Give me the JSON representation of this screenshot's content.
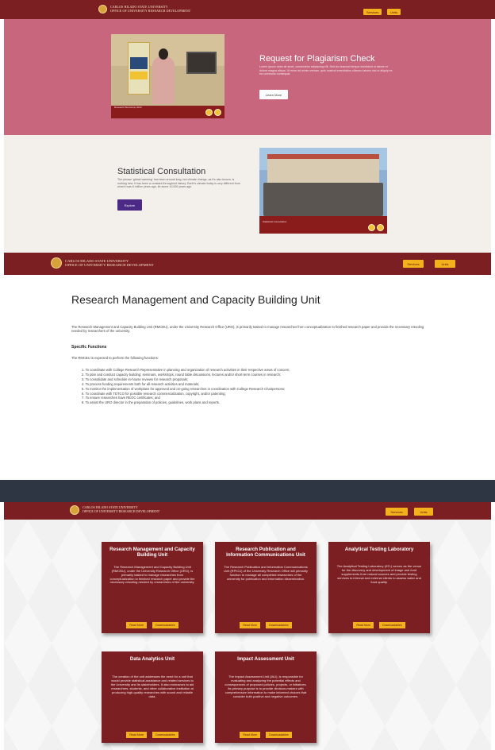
{
  "header": {
    "org_line1": "CARLOS HILADO STATE UNIVERSITY",
    "org_line2": "OFFICE OF UNIVERSITY RESEARCH DEVELOPMENT",
    "btn_left": "Services",
    "btn_right": "Units"
  },
  "plagiarism": {
    "title": "Request for Plagiarism Check",
    "description": "Lorem ipsum dolor sit amet, consectetur adipiscing elit. Sed do eiusmod tempor incididunt ut labore et dolore magna aliqua. Ut enim ad minim veniam, quis nostrud exercitation ullamco laboris nisi ut aliquip ex ea commodo consequat.",
    "button": "Learn More",
    "photo_caption": "Research Bootcamp 2022",
    "banner_text": "RESEARCH BOOTCAMP 2022"
  },
  "statistical": {
    "title": "Statistical Consultation",
    "description": "The phrase 'global warming' has been around long, but climate change, as it's also known, is nothing new. It has been a constant throughout history. Earth's climate today is very different from what it was 8 million years ago, let alone 10,000 years ago.",
    "button": "Explore",
    "photo_caption": "Statistical Consultation"
  },
  "rm_unit": {
    "title": "Research Management and Capacity Building Unit",
    "intro": "The Research Management and Capacity Building Unit (RMCBU), under the University Research Office (URO), is primarily tasked to manage researches from conceptualization to finished research paper and provide the necessary retooling needed by researchers of the university.",
    "functions_heading": "Specific Functions",
    "expected": "The RMCBU is expected to perform the following functions:",
    "functions": [
      "1. To coordinate with College Research Representative in planning and organization of research activities in their respective areas of concern;",
      "2. To plan and conduct capacity building: seminars, workshops, round table discussions, lectures and/or short-term courses in research;",
      "3. To consolidate and schedule in-house reviews for research proposals;",
      "4. To process funding requirements both for all research activities and materials;",
      "5. To monitor the implementation of workplans for approved and on-going researches in coordination with College Research Chairpersons;",
      "6. To coordinate with TDTCO for possible research commercialization, copyright, and/or patenting;",
      "7. To ensure researches have REOC certificates; and",
      "8. To assist the URO director in the preparation of policies, guidelines, work plans and reports."
    ]
  },
  "units": {
    "read_more": "Read More",
    "downloadables": "Downloadables",
    "cards": [
      {
        "title": "Research Management and Capacity Building Unit",
        "description": "The Research Management and Capacity Building Unit (RMCBU), under the University Research Office (URO), is primarily tasked to manage researches from conceptualization to finished research paper and provide the necessary retooling needed by researchers of the university."
      },
      {
        "title": "Research Publication and Information Communications Unit",
        "description": "The Research Publication and Information Communications Unit (RPICU) of the University Research Office will primarily function to manage all completed researches of the university for publication and information dissemination."
      },
      {
        "title": "Analytical Testing Laboratory",
        "description": "The Analytical Testing Laboratory (ATL) serves as the venue for the discovery and development of image and food supplements from natural sources and provide testing services to internal and external clients to assess water and food quality."
      },
      {
        "title": "Data Analytics Unit",
        "description": "The creation of the unit addresses the need for a unit that would provide statistical assistance and related services to the University and its stakeholders. It also endeavors to aid researchers, students, and other collaborative institution at producing high-quality researches with sound and reliable data."
      },
      {
        "title": "Impact Assessment Unit",
        "description": "The Impact Assessment Unit (IAU), is responsible for evaluating and analyzing the potential effects and consequences of proposed policies, projects, or initiatives. Its primary purpose is to provide decision-makers with comprehensive information to make informed choices that consider both positive and negative outcomes."
      }
    ]
  },
  "colors": {
    "maroon": "#7c1f23",
    "rose": "#c7667d",
    "gold": "#f3b11c",
    "purple": "#4b2a86",
    "dark_band": "#2e3643"
  }
}
